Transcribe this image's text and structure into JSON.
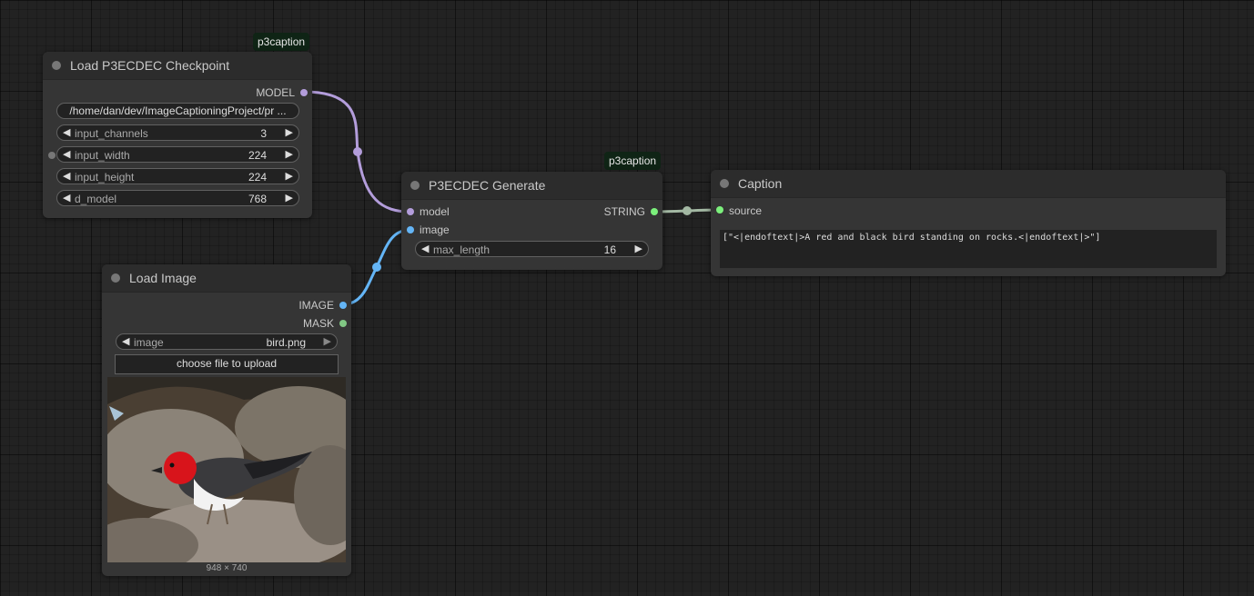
{
  "colors": {
    "background": "#222222",
    "node_body": "#353535",
    "node_header": "#2c2c2c",
    "model_link": "#b39ddb",
    "image_link": "#64b5f6",
    "string_link": "#a3b8a3",
    "model_slot": "#b39ddb",
    "image_slot": "#64b5f6",
    "mask_slot": "#81c784",
    "string_slot": "#7cf07c"
  },
  "checkpoint_node": {
    "badge": "p3caption",
    "title": "Load P3ECDEC Checkpoint",
    "output_model": "MODEL",
    "path_value": "/home/dan/dev/ImageCaptioningProject/pr ...",
    "widgets": [
      {
        "label": "input_channels",
        "value": "3"
      },
      {
        "label": "input_width",
        "value": "224"
      },
      {
        "label": "input_height",
        "value": "224"
      },
      {
        "label": "d_model",
        "value": "768"
      }
    ]
  },
  "generate_node": {
    "badge": "p3caption",
    "title": "P3ECDEC Generate",
    "input_model": "model",
    "input_image": "image",
    "output_string": "STRING",
    "widget": {
      "label": "max_length",
      "value": "16"
    }
  },
  "caption_node": {
    "title": "Caption",
    "input_source": "source",
    "text": "[\"<|endoftext|>A red and black bird standing on rocks.<|endoftext|>\"]"
  },
  "load_image_node": {
    "title": "Load Image",
    "output_image": "IMAGE",
    "output_mask": "MASK",
    "widget": {
      "label": "image",
      "value": "bird.png"
    },
    "upload_label": "choose file to upload",
    "image_dims": "948 × 740"
  }
}
